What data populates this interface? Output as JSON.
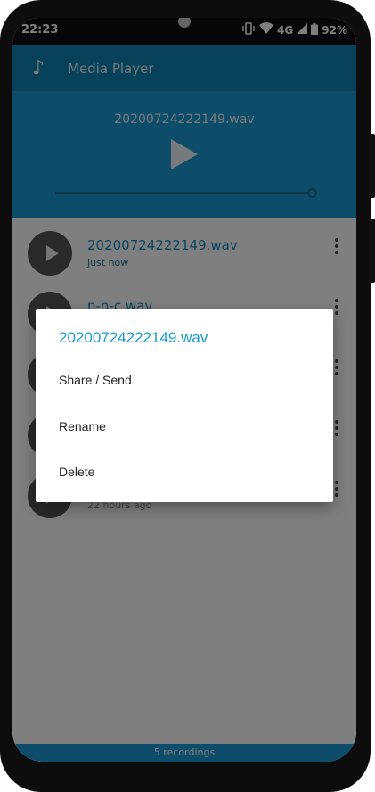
{
  "status_bar": {
    "time": "22:23",
    "network": "4G",
    "battery": "92%"
  },
  "header": {
    "icon": "music-note-icon",
    "title": "Media Player"
  },
  "player": {
    "current_file": "20200724222149.wav",
    "progress": 1.0
  },
  "recordings": [
    {
      "name": "20200724222149.wav",
      "time": "just now"
    },
    {
      "name": "n-n-c.wav",
      "time": ""
    },
    {
      "name": "",
      "time": ""
    },
    {
      "name": "",
      "time": ""
    },
    {
      "name": "",
      "time": "22 hours ago"
    }
  ],
  "footer": {
    "count_label": "5 recordings"
  },
  "dialog": {
    "title": "20200724222149.wav",
    "options": [
      "Share / Send",
      "Rename",
      "Delete"
    ]
  },
  "colors": {
    "primary": "#1a9bd2",
    "primary_dark": "#0f83b4",
    "accent_text": "#1688bb"
  }
}
